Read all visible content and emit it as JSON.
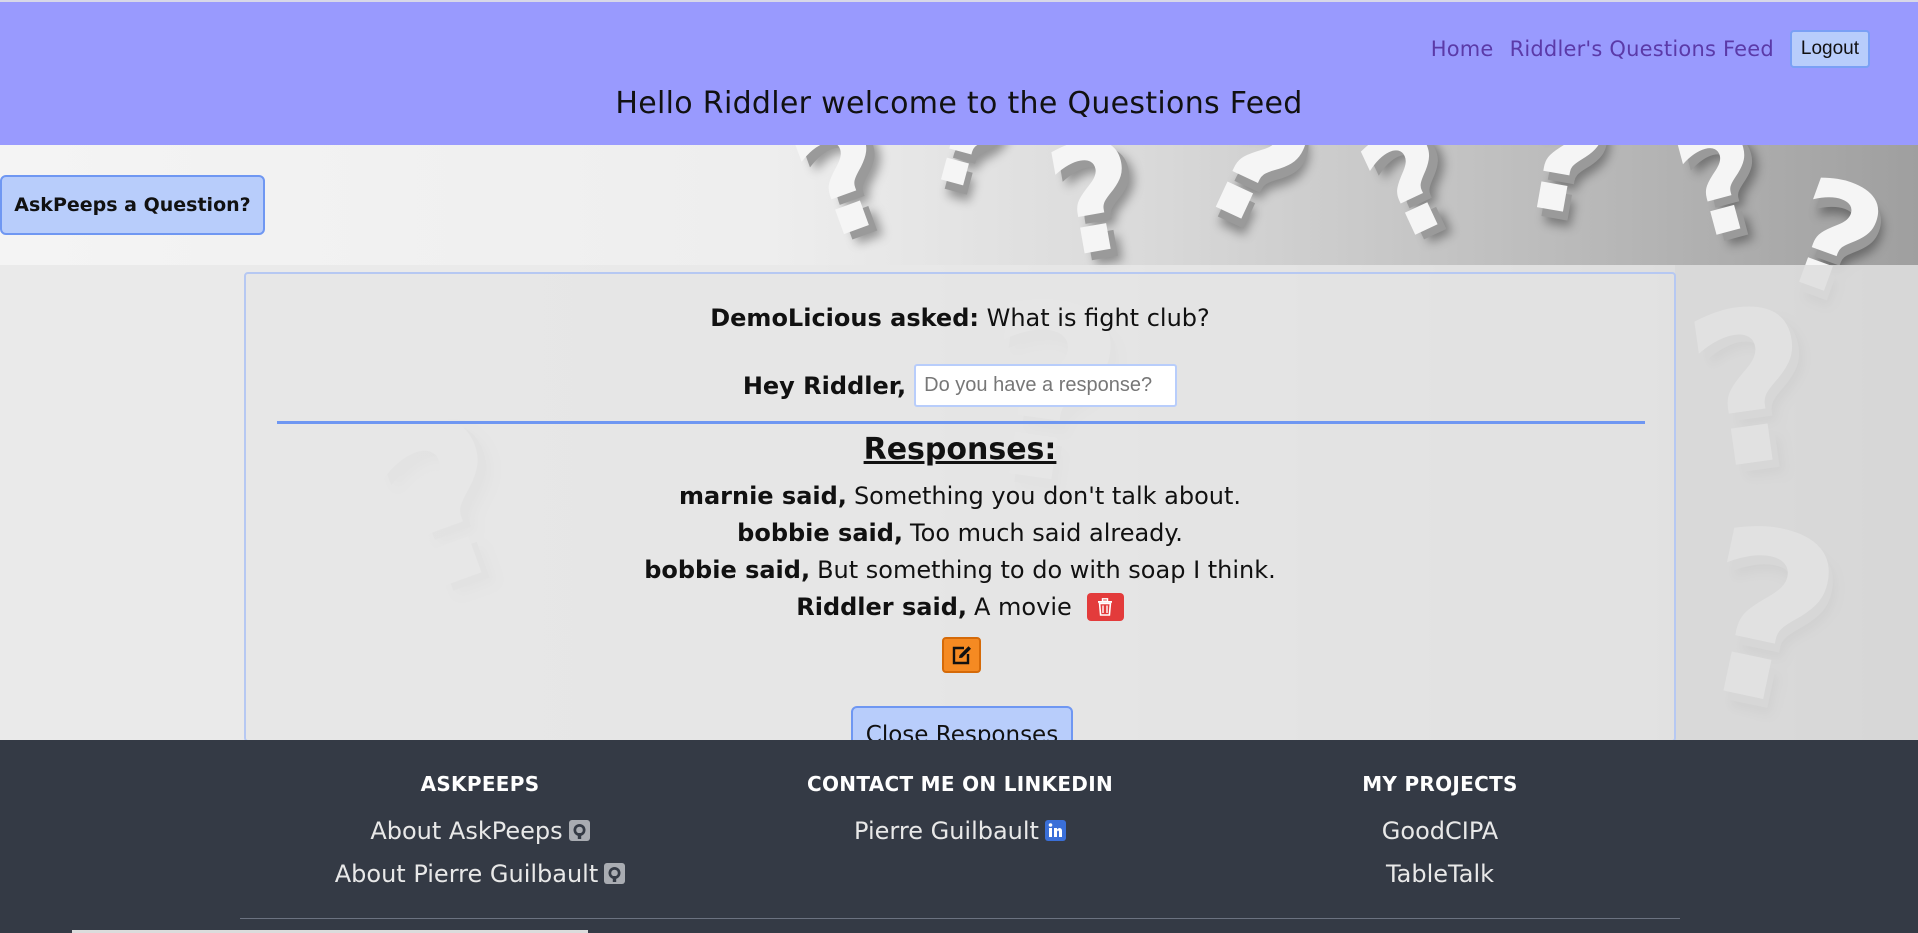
{
  "nav": {
    "home": "Home",
    "feed": "Riddler's Questions Feed",
    "logout": "Logout"
  },
  "welcome": "Hello Riddler welcome to the Questions Feed",
  "ask_button": "AskPeeps a Question?",
  "question": {
    "asker": "DemoLicious asked:",
    "text": "What is fight club?",
    "reply_label": "Hey Riddler,",
    "reply_placeholder": "Do you have a response?"
  },
  "responses": {
    "title": "Responses:",
    "items": [
      {
        "author": "marnie said,",
        "text": "Something you don't talk about."
      },
      {
        "author": "bobbie said,",
        "text": "Too much said already."
      },
      {
        "author": "bobbie said,",
        "text": "But something to do with soap I think."
      },
      {
        "author": "Riddler said,",
        "text": "A movie"
      }
    ],
    "close_button": "Close Responses"
  },
  "icons": {
    "delete": "trash-icon",
    "edit": "edit-icon",
    "github": "github-icon",
    "linkedin": "linkedin-icon"
  },
  "colors": {
    "header": "#999afe",
    "button": "#b8cdfb",
    "button_border": "#6f97f2",
    "delete": "#e33b3b",
    "edit": "#f58a22",
    "footer": "#343a45",
    "link": "#5b3aa8",
    "linkedin": "#3a6fd8"
  },
  "footer": {
    "col1": {
      "title": "ASKPEEPS",
      "links": [
        "About AskPeeps",
        "About Pierre Guilbault"
      ]
    },
    "col2": {
      "title": "CONTACT ME ON LINKEDIN",
      "links": [
        "Pierre Guilbault"
      ]
    },
    "col3": {
      "title": "MY PROJECTS",
      "links": [
        "GoodCIPA",
        "TableTalk"
      ]
    }
  }
}
